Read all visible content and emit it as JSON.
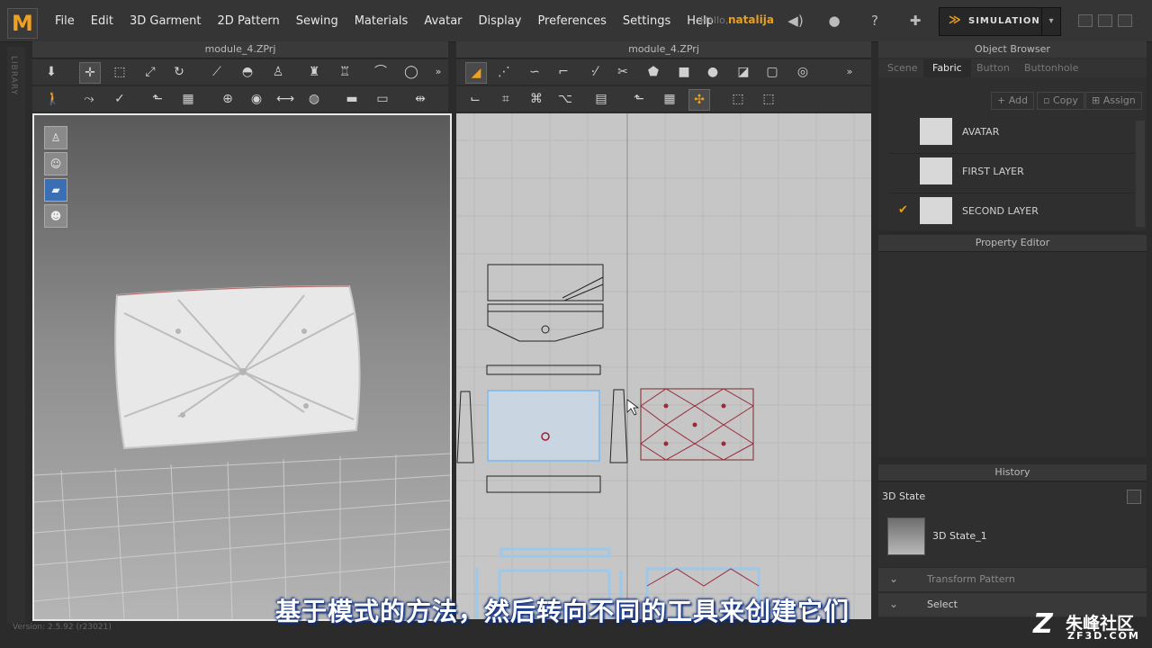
{
  "menubar": {
    "logo": "M",
    "items": [
      "File",
      "Edit",
      "3D Garment",
      "2D Pattern",
      "Sewing",
      "Materials",
      "Avatar",
      "Display",
      "Preferences",
      "Settings",
      "Help"
    ],
    "hello": "Hello,",
    "user": "natalija",
    "simulation": "SIMULATION"
  },
  "library_label": "LIBRARY",
  "left_panel": {
    "title": "module_4.ZPrj"
  },
  "right_panel": {
    "title": "module_4.ZPrj"
  },
  "object_browser": {
    "title": "Object Browser",
    "tabs": [
      "Scene",
      "Fabric",
      "Button",
      "Buttonhole"
    ],
    "active_tab": "Fabric",
    "actions": [
      "Add",
      "Copy",
      "Assign"
    ],
    "fabrics": [
      {
        "name": "AVATAR",
        "checked": false
      },
      {
        "name": "FIRST LAYER",
        "checked": false
      },
      {
        "name": "SECOND LAYER",
        "checked": true
      }
    ]
  },
  "property_editor": {
    "title": "Property Editor"
  },
  "history": {
    "title": "History",
    "state_label": "3D State",
    "state_item": "3D State_1",
    "rows": [
      "Transform Pattern",
      "Select"
    ]
  },
  "version": "Version: 2.5.92   (r23021)",
  "subtitle": "基于模式的方法，然后转向不同的工具来创建它们",
  "watermark": {
    "z": "Z",
    "cn": "朱峰社区",
    "en": "ZF3D.COM"
  },
  "icons": {
    "volume": "speaker-icon",
    "user": "user-icon",
    "help": "help-icon",
    "garment": "garment-icon"
  }
}
